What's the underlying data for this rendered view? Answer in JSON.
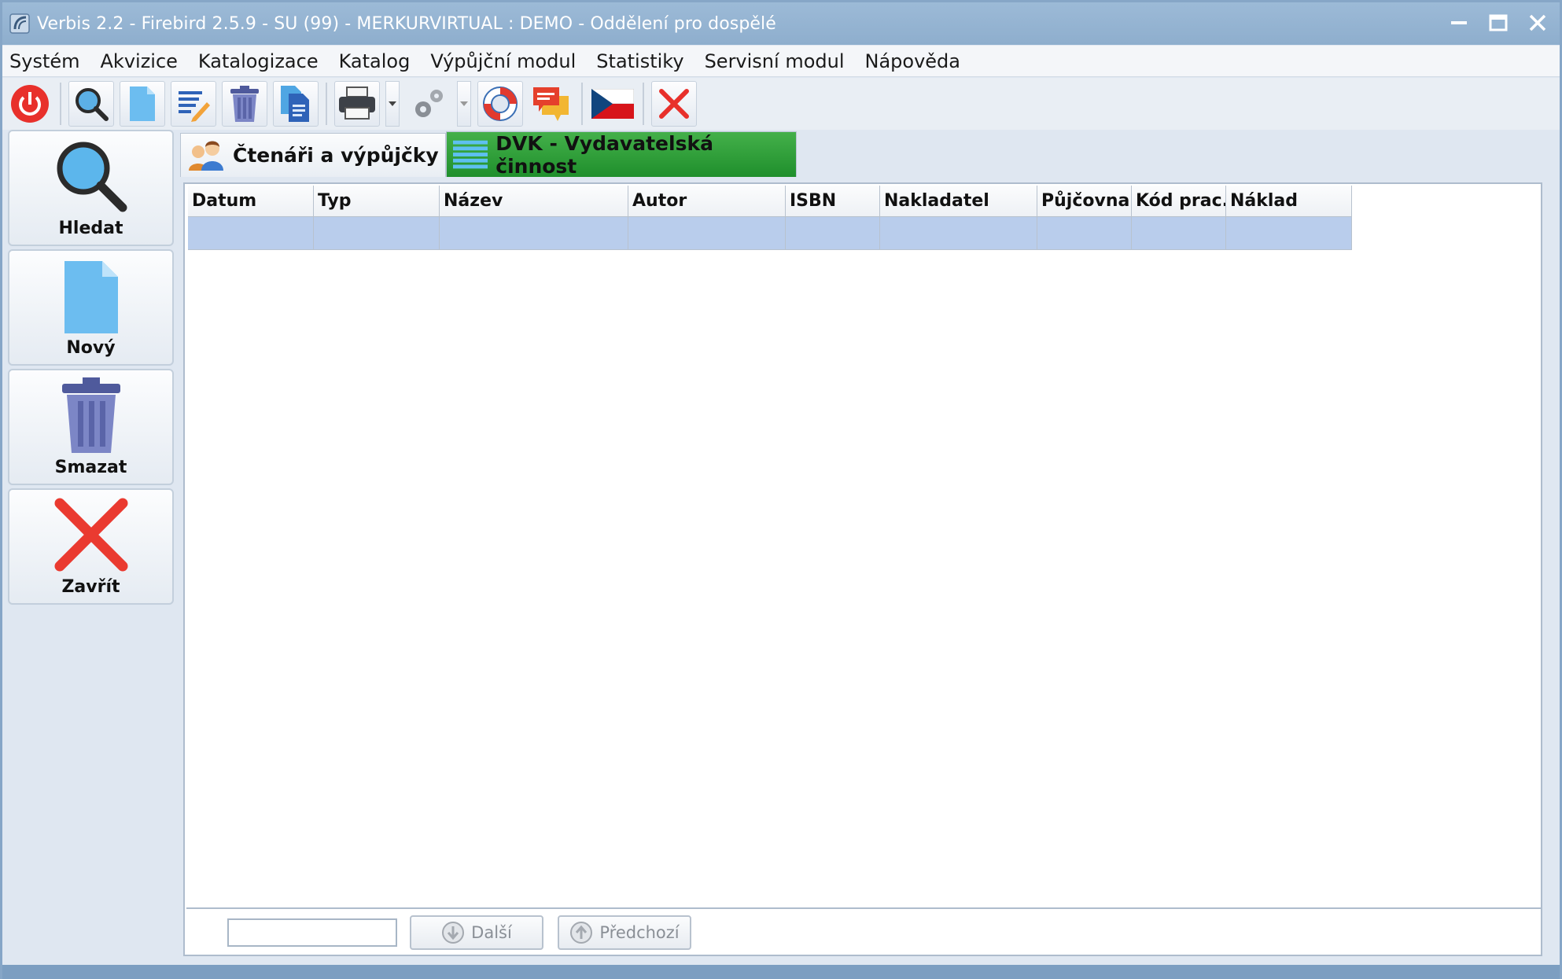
{
  "window": {
    "title": "Verbis 2.2 - Firebird 2.5.9 - SU (99) - MERKURVIRTUAL : DEMO - Oddělení pro dospělé"
  },
  "menu": [
    "Systém",
    "Akvizice",
    "Katalogizace",
    "Katalog",
    "Výpůjční modul",
    "Statistiky",
    "Servisní modul",
    "Nápověda"
  ],
  "toolbar": {
    "icons": [
      "power-icon",
      "search-icon",
      "new-document-icon",
      "edit-document-icon",
      "trash-icon",
      "copy-document-icon",
      "printer-icon",
      "gears-icon",
      "lifebuoy-icon",
      "chat-icon",
      "czech-flag-icon",
      "close-icon"
    ]
  },
  "sidebar": {
    "search_label": "Hledat",
    "new_label": "Nový",
    "delete_label": "Smazat",
    "close_label": "Zavřít"
  },
  "tabs": [
    {
      "label": "Čtenáři a výpůjčky",
      "active": false
    },
    {
      "label": "DVK - Vydavatelská činnost",
      "active": true
    }
  ],
  "grid": {
    "columns": [
      "Datum",
      "Typ",
      "Název",
      "Autor",
      "ISBN",
      "Nakladatel",
      "Půjčovna",
      "Kód prac.",
      "Náklad"
    ],
    "rows": [
      [
        "",
        "",
        "",
        "",
        "",
        "",
        "",
        "",
        ""
      ]
    ]
  },
  "footer": {
    "goto_value": "",
    "next_label": "Další",
    "prev_label": "Předchozí"
  },
  "colors": {
    "active_tab": "#2ea03a",
    "selected_row": "#b9cdec",
    "title_bar": "#94b3d2"
  }
}
